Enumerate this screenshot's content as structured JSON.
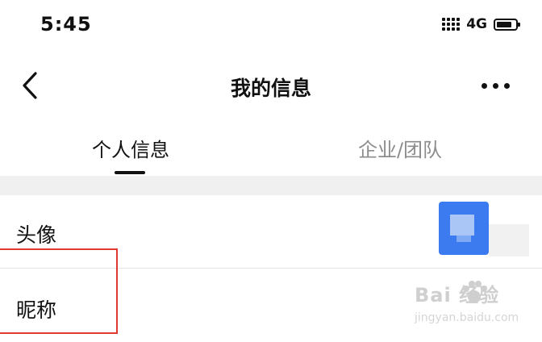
{
  "status_bar": {
    "time": "5:45",
    "network": "4G",
    "signal_icon": "signal-dots-icon",
    "battery_icon": "battery-icon"
  },
  "nav": {
    "title": "我的信息",
    "back_icon": "chevron-left-icon",
    "more_icon": "more-dots-icon"
  },
  "tabs": [
    {
      "label": "个人信息",
      "active": true
    },
    {
      "label": "企业/团队",
      "active": false
    }
  ],
  "rows": {
    "avatar_label": "头像",
    "nickname_label": "昵称"
  },
  "watermark": {
    "main": "Bai 经验",
    "sub": "jingyan.baidu.com"
  },
  "colors": {
    "accent_avatar": "#3b7bef",
    "highlight_box": "#e03a30",
    "tab_inactive": "#8c8c8c",
    "divider_band": "#f0f0f0"
  }
}
